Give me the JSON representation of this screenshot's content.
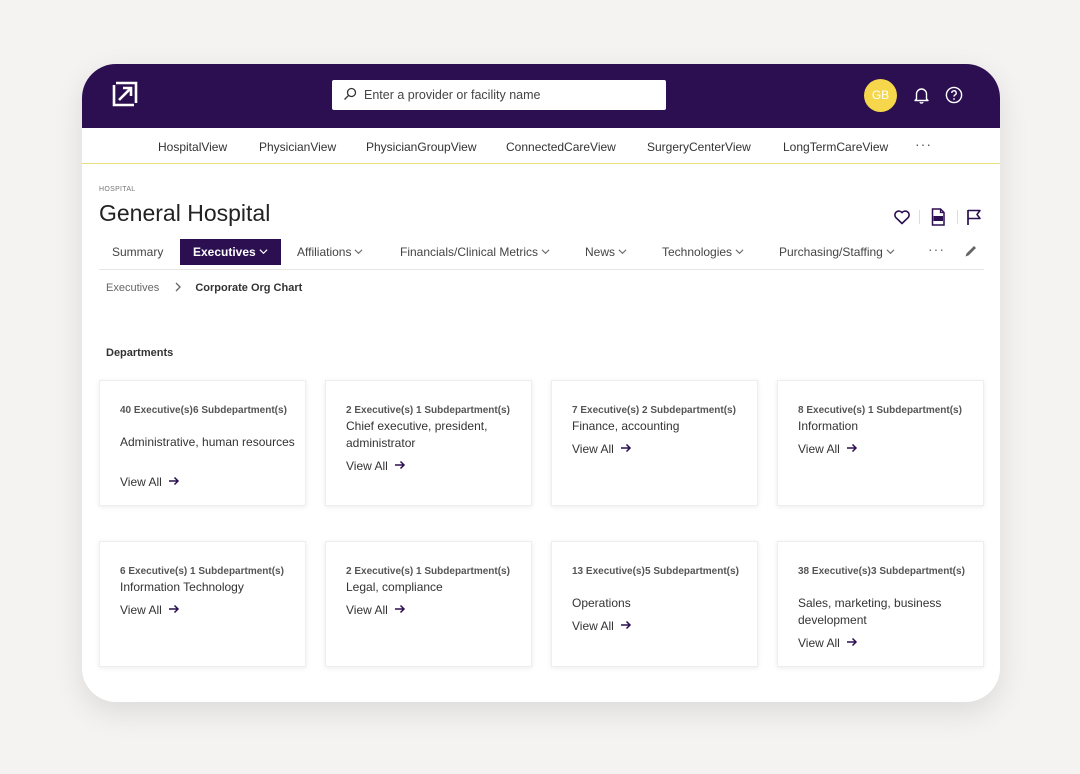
{
  "header": {
    "search_placeholder": "Enter a provider or facility name",
    "avatar_initials": "GB",
    "colors": {
      "brand": "#2b0f50",
      "avatar": "#f6d64b"
    }
  },
  "product_nav": [
    "HospitalView",
    "PhysicianView",
    "PhysicianGroupView",
    "ConnectedCareView",
    "SurgeryCenterView",
    "LongTermCareView"
  ],
  "product_nav_more": "···",
  "page": {
    "kicker": "HOSPITAL",
    "title": "General Hospital"
  },
  "tabs": [
    {
      "label": "Summary",
      "has_dropdown": false,
      "active": false
    },
    {
      "label": "Executives",
      "has_dropdown": true,
      "active": true
    },
    {
      "label": "Affiliations",
      "has_dropdown": true,
      "active": false
    },
    {
      "label": "Financials/Clinical Metrics",
      "has_dropdown": true,
      "active": false
    },
    {
      "label": "News",
      "has_dropdown": true,
      "active": false
    },
    {
      "label": "Technologies",
      "has_dropdown": true,
      "active": false
    },
    {
      "label": "Purchasing/Staffing",
      "has_dropdown": true,
      "active": false
    }
  ],
  "tabs_more": "···",
  "breadcrumb": {
    "parent": "Executives",
    "current": "Corporate Org Chart"
  },
  "section_title": "Departments",
  "view_all_label": "View All",
  "departments": [
    {
      "executives": "40 Executive(s)",
      "subdepartments": "6 Subdepartment(s)",
      "name": "Administrative, human resources"
    },
    {
      "executives": "2 Executive(s)",
      "subdepartments": "1 Subdepartment(s)",
      "name": "Chief executive, president, administrator"
    },
    {
      "executives": "7 Executive(s)",
      "subdepartments": "2 Subdepartment(s)",
      "name": "Finance, accounting"
    },
    {
      "executives": "8 Executive(s)",
      "subdepartments": "1 Subdepartment(s)",
      "name": "Information"
    },
    {
      "executives": "6 Executive(s)",
      "subdepartments": "1 Subdepartment(s)",
      "name": "Information Technology"
    },
    {
      "executives": "2 Executive(s)",
      "subdepartments": "1 Subdepartment(s)",
      "name": "Legal, compliance"
    },
    {
      "executives": "13 Executive(s)",
      "subdepartments": "5 Subdepartment(s)",
      "name": "Operations"
    },
    {
      "executives": "38 Executive(s)",
      "subdepartments": "3 Subdepartment(s)",
      "name": "Sales, marketing, business development"
    }
  ]
}
